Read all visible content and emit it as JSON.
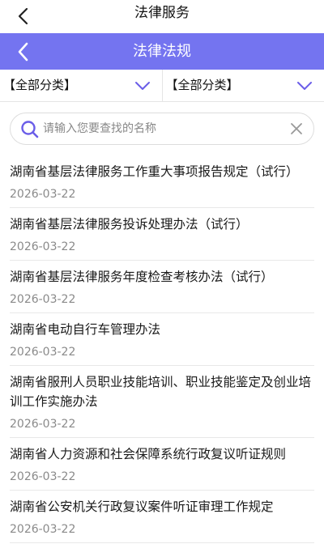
{
  "topbar": {
    "title": "法律服务",
    "back_icon": "back-arrow-icon"
  },
  "subbar": {
    "title": "法律法规",
    "back_icon": "back-arrow-icon",
    "color": "#7474f0"
  },
  "filters": [
    {
      "label": "【全部分类】",
      "icon": "chevron-down-icon"
    },
    {
      "label": "【全部分类】",
      "icon": "chevron-down-icon"
    }
  ],
  "search": {
    "placeholder": "请输入您要查找的名称",
    "value": "",
    "icon": "search-icon",
    "clear_icon": "close-icon"
  },
  "items": [
    {
      "title": "湖南省基层法律服务工作重大事项报告规定（试行）",
      "date": "2026-03-22"
    },
    {
      "title": "湖南省基层法律服务投诉处理办法（试行）",
      "date": "2026-03-22"
    },
    {
      "title": "湖南省基层法律服务年度检查考核办法（试行）",
      "date": "2026-03-22"
    },
    {
      "title": "湖南省电动自行车管理办法",
      "date": "2026-03-22"
    },
    {
      "title": "湖南省服刑人员职业技能培训、职业技能鉴定及创业培训工作实施办法",
      "date": "2026-03-22"
    },
    {
      "title": "湖南省人力资源和社会保障系统行政复议听证规则",
      "date": "2026-03-22"
    },
    {
      "title": "湖南省公安机关行政复议案件听证审理工作规定",
      "date": "2026-03-22"
    }
  ]
}
